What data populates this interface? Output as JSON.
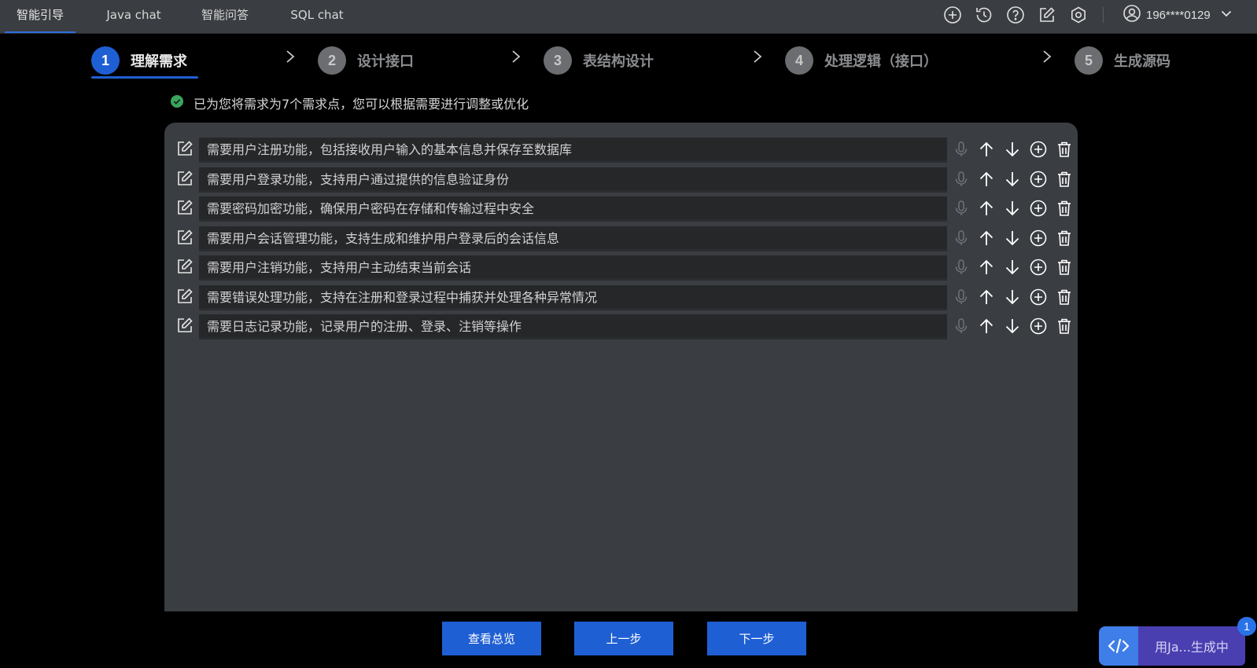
{
  "topbar": {
    "tabs": [
      {
        "label": "智能引导",
        "active": true
      },
      {
        "label": "Java chat",
        "active": false
      },
      {
        "label": "智能问答",
        "active": false
      },
      {
        "label": "SQL chat",
        "active": false
      }
    ],
    "icons": [
      "add-circle-icon",
      "history-icon",
      "help-icon",
      "edit-icon",
      "settings-icon"
    ],
    "user": "196****0129"
  },
  "stepper": {
    "steps": [
      {
        "num": "1",
        "label": "理解需求",
        "active": true
      },
      {
        "num": "2",
        "label": "设计接口",
        "active": false
      },
      {
        "num": "3",
        "label": "表结构设计",
        "active": false
      },
      {
        "num": "4",
        "label": "处理逻辑（接口）",
        "active": false
      },
      {
        "num": "5",
        "label": "生成源码",
        "active": false
      }
    ]
  },
  "info": "已为您将需求为7个需求点，您可以根据需要进行调整或优化",
  "requirements": [
    "需要用户注册功能，包括接收用户输入的基本信息并保存至数据库",
    "需要用户登录功能，支持用户通过提供的信息验证身份",
    "需要密码加密功能，确保用户密码在存储和传输过程中安全",
    "需要用户会话管理功能，支持生成和维护用户登录后的会话信息",
    "需要用户注销功能，支持用户主动结束当前会话",
    "需要错误处理功能，支持在注册和登录过程中捕获并处理各种异常情况",
    "需要日志记录功能，记录用户的注册、登录、注销等操作"
  ],
  "buttons": {
    "overview": "查看总览",
    "prev": "上一步",
    "next": "下一步"
  },
  "fab": {
    "label": "用Ja...生成中",
    "count": "1"
  },
  "colors": {
    "accent": "#1f5fd4",
    "success": "#3aa55d",
    "fab": "#4a3fb0"
  }
}
